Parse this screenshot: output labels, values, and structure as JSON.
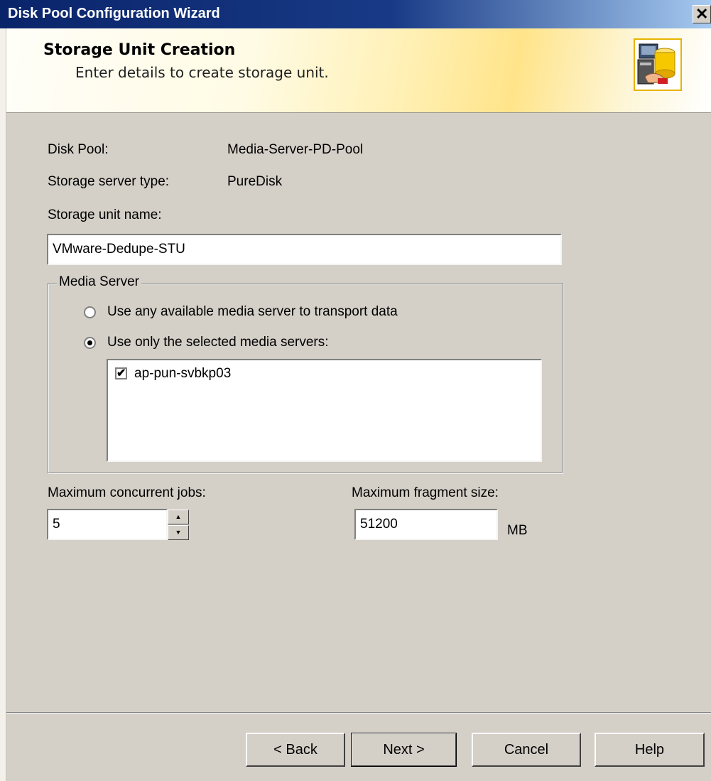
{
  "window": {
    "title": "Disk Pool Configuration Wizard",
    "close_glyph": "✕"
  },
  "header": {
    "title": "Storage Unit Creation",
    "subtitle": "Enter details to create storage unit.",
    "icon": "disk-storage-icon"
  },
  "details": {
    "disk_pool_label": "Disk Pool:",
    "disk_pool_value": "Media-Server-PD-Pool",
    "server_type_label": "Storage server type:",
    "server_type_value": "PureDisk",
    "stu_name_label": "Storage unit name:",
    "stu_name_value": "VMware-Dedupe-STU"
  },
  "media_server": {
    "legend": "Media Server",
    "option_any": "Use any available media server to transport data",
    "option_selected": "Use only the selected media servers:",
    "selected_option": "option_selected",
    "servers": [
      {
        "name": "ap-pun-svbkp03",
        "checked": true
      }
    ]
  },
  "limits": {
    "max_jobs_label": "Maximum concurrent jobs:",
    "max_jobs_value": "5",
    "max_fragment_label": "Maximum fragment size:",
    "max_fragment_value": "51200",
    "fragment_unit": "MB"
  },
  "buttons": {
    "back": "< Back",
    "next": "Next >",
    "cancel": "Cancel",
    "help": "Help"
  },
  "colors": {
    "title_bar": "#0a246a",
    "dialog_bg": "#d4d0c8",
    "header_accent": "#ffe48a"
  }
}
